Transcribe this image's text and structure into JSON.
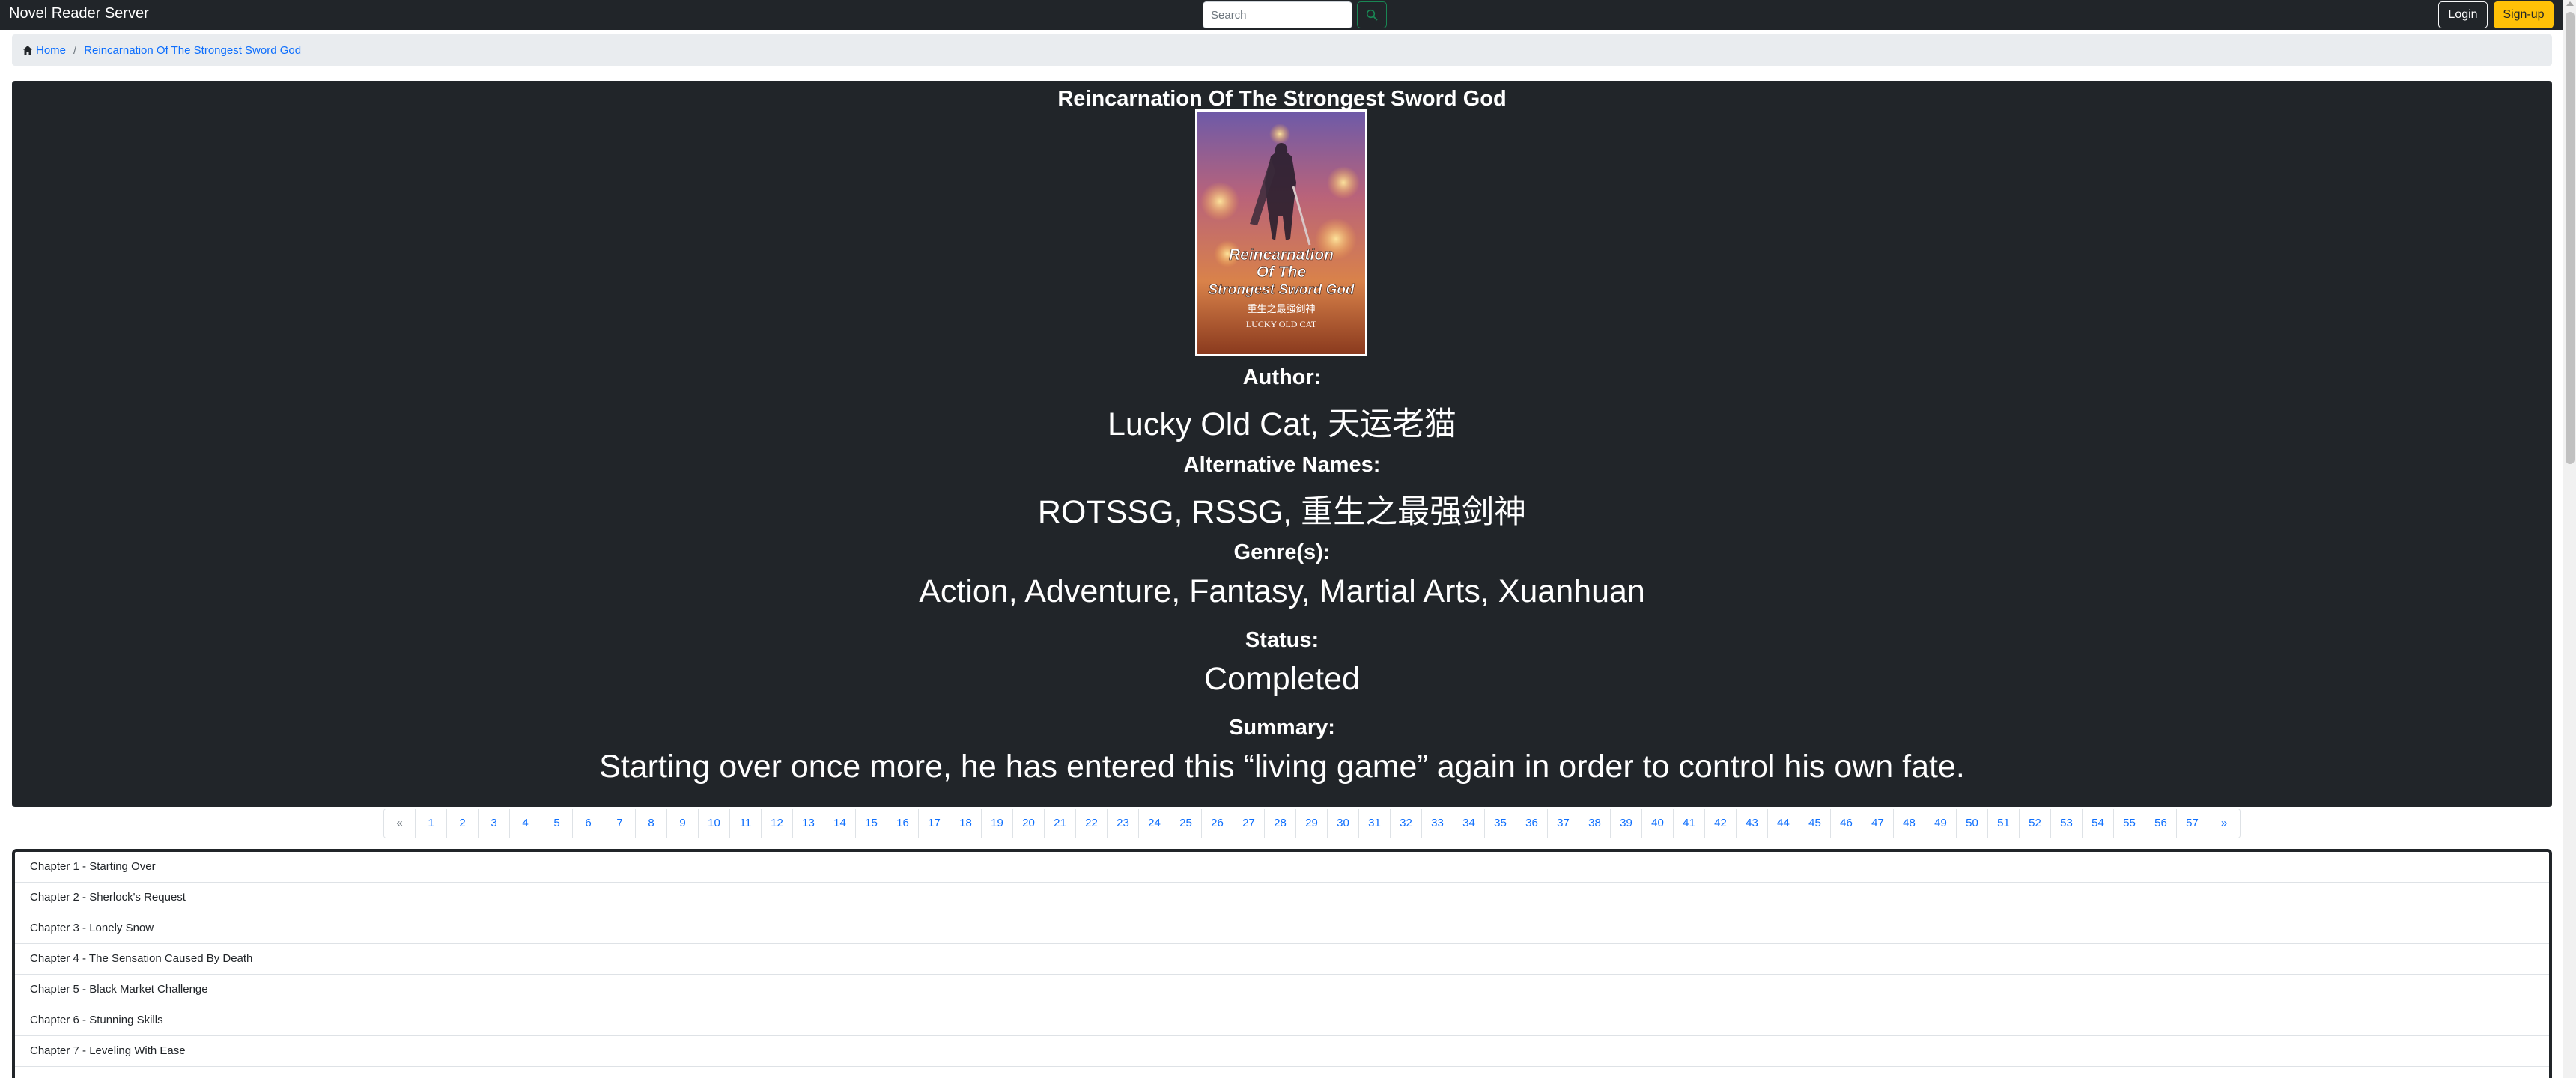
{
  "navbar": {
    "brand": "Novel Reader Server",
    "search_placeholder": "Search",
    "search_icon": "search-icon",
    "login_label": "Login",
    "signup_label": "Sign-up"
  },
  "breadcrumb": {
    "icon": "house-icon",
    "home": "Home",
    "current": "Reincarnation Of The Strongest Sword God"
  },
  "novel": {
    "title": "Reincarnation Of The Strongest Sword God",
    "cover": {
      "line1": "Reincarnation",
      "line2": "Of The",
      "line3": "Strongest Sword God",
      "chinese": "重生之最强剑神",
      "author": "LUCKY OLD CAT"
    },
    "author_label": "Author:",
    "author": "Lucky Old Cat, 天运老猫",
    "alt_label": "Alternative Names:",
    "alt_names": "ROTSSG, RSSG, 重生之最强剑神",
    "genres_label": "Genre(s):",
    "genres": "Action, Adventure, Fantasy, Martial Arts, Xuanhuan",
    "status_label": "Status:",
    "status": "Completed",
    "summary_label": "Summary:",
    "summary": "Starting over once more, he has entered this “living game” again in order to control his own fate."
  },
  "pagination": {
    "prev": "«",
    "next": "»",
    "pages": [
      "1",
      "2",
      "3",
      "4",
      "5",
      "6",
      "7",
      "8",
      "9",
      "10",
      "11",
      "12",
      "13",
      "14",
      "15",
      "16",
      "17",
      "18",
      "19",
      "20",
      "21",
      "22",
      "23",
      "24",
      "25",
      "26",
      "27",
      "28",
      "29",
      "30",
      "31",
      "32",
      "33",
      "34",
      "35",
      "36",
      "37",
      "38",
      "39",
      "40",
      "41",
      "42",
      "43",
      "44",
      "45",
      "46",
      "47",
      "48",
      "49",
      "50",
      "51",
      "52",
      "53",
      "54",
      "55",
      "56",
      "57"
    ]
  },
  "chapters": [
    "Chapter 1 - Starting Over",
    "Chapter 2 - Sherlock's Request",
    "Chapter 3 - Lonely Snow",
    "Chapter 4 - The Sensation Caused By Death",
    "Chapter 5 - Black Market Challenge",
    "Chapter 6 - Stunning Skills",
    "Chapter 7 - Leveling With Ease"
  ],
  "colors": {
    "navbar_bg": "#212529",
    "link": "#0d6efd",
    "signup": "#ffc107",
    "search_button_border": "#198754"
  }
}
